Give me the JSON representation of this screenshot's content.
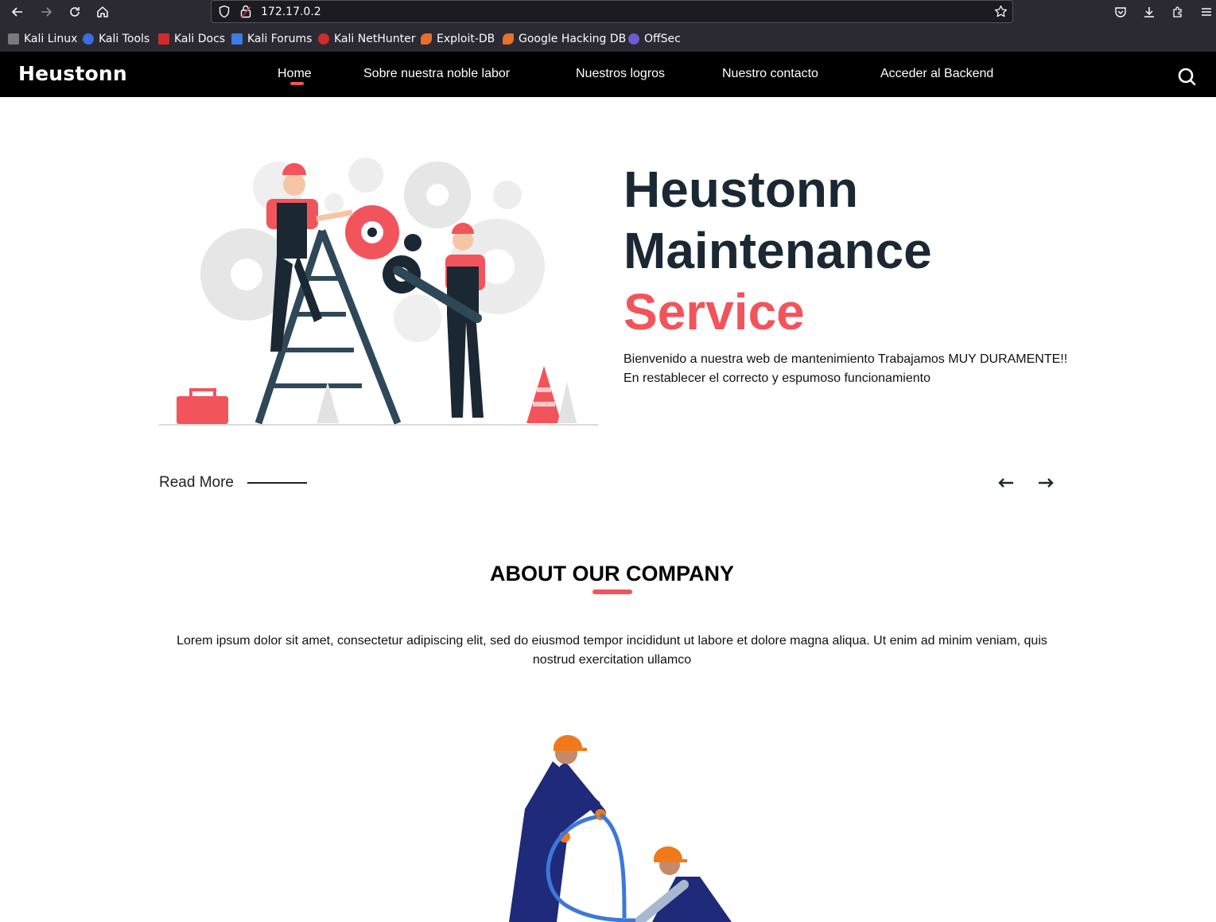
{
  "browser": {
    "url": "172.17.0.2",
    "bookmarks": [
      {
        "label": "Kali Linux",
        "icon": "kali-dragon-icon",
        "color": "#7a7a7a"
      },
      {
        "label": "Kali Tools",
        "icon": "kali-tools-icon",
        "color": "#3b6de0"
      },
      {
        "label": "Kali Docs",
        "icon": "kali-docs-icon",
        "color": "#d12b2b"
      },
      {
        "label": "Kali Forums",
        "icon": "kali-forums-icon",
        "color": "#3b7de0"
      },
      {
        "label": "Kali NetHunter",
        "icon": "kali-nethunter-icon",
        "color": "#d12b2b"
      },
      {
        "label": "Exploit-DB",
        "icon": "exploit-db-icon",
        "color": "#e8702a"
      },
      {
        "label": "Google Hacking DB",
        "icon": "ghdb-icon",
        "color": "#e8702a"
      },
      {
        "label": "OffSec",
        "icon": "offsec-icon",
        "color": "#6d5bd0"
      }
    ]
  },
  "site": {
    "logo": "Heustonn",
    "nav": [
      {
        "label": "Home",
        "active": true
      },
      {
        "label": "Sobre nuestra noble labor"
      },
      {
        "label": "Nuestros logros"
      },
      {
        "label": "Nuestro contacto"
      },
      {
        "label": "Acceder al Backend"
      }
    ],
    "accent_color": "#f2545b"
  },
  "hero": {
    "title_line1": "Heustonn",
    "title_line2": "Maintenance",
    "title_accent": "Service",
    "text_line1": "Bienvenido a nuestra web de mantenimiento Trabajamos MUY DURAMENTE!!",
    "text_line2": "En restablecer el correcto y espumoso funcionamiento",
    "read_more": "Read More"
  },
  "about": {
    "title": "ABOUT OUR COMPANY",
    "text": "Lorem ipsum dolor sit amet, consectetur adipiscing elit, sed do eiusmod tempor incididunt ut labore et dolore magna aliqua. Ut enim ad minim veniam, quis nostrud exercitation ullamco"
  }
}
